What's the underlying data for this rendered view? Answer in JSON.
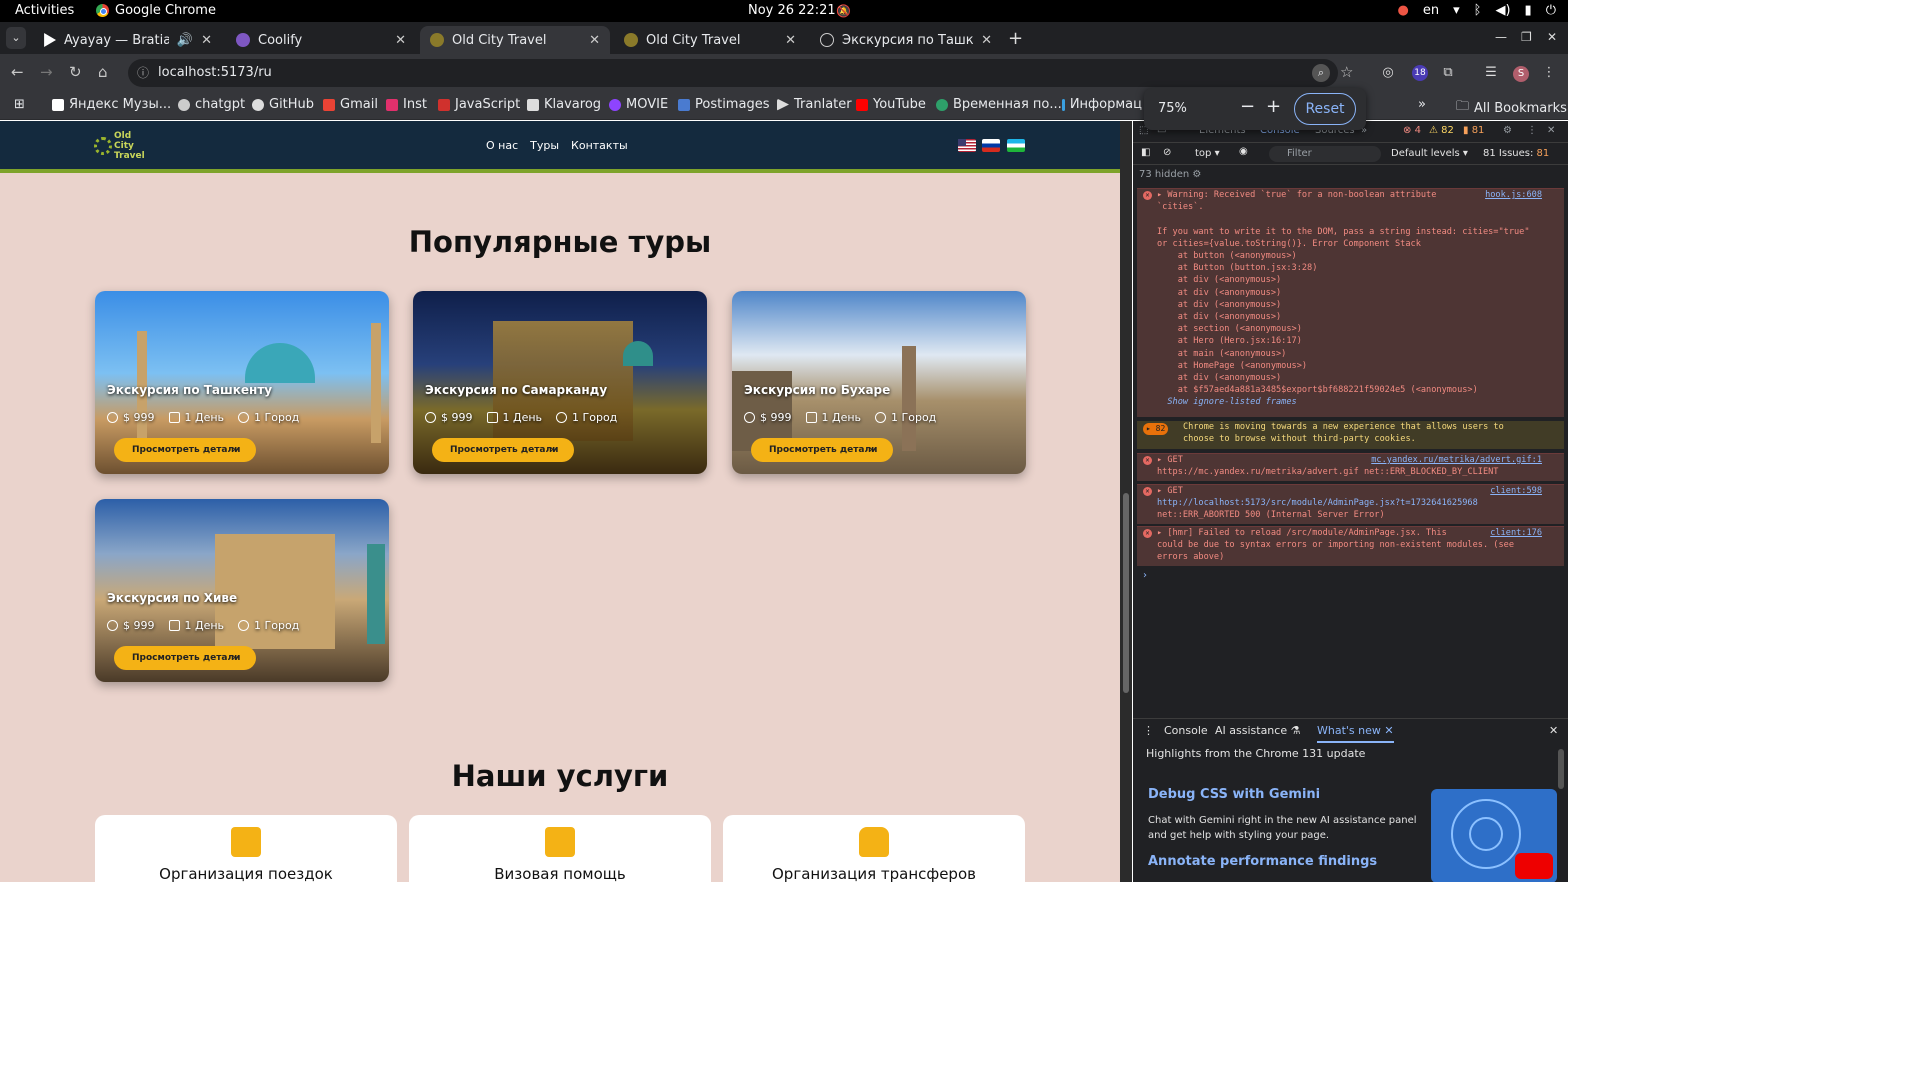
{
  "system": {
    "activities": "Activities",
    "app_name": "Google Chrome",
    "clock": "Noy 26  22:21",
    "lang": "en"
  },
  "tabs": [
    {
      "title": "Ayayay — Bratia Stere",
      "color": "#ffffff"
    },
    {
      "title": "Coolify",
      "color": "#7e57c2"
    },
    {
      "title": "Old City Travel",
      "color": "#8a7a2a"
    },
    {
      "title": "Old City Travel",
      "color": "#8a7a2a"
    },
    {
      "title": "Экскурсия по Ташкенту",
      "color": "#cccccc"
    }
  ],
  "address": "localhost:5173/ru",
  "extension_badge": "18",
  "avatar_letter": "S",
  "bookmarks": [
    {
      "label": "Яндекс Музы...",
      "color": "#ffffff"
    },
    {
      "label": "chatgpt",
      "color": "#cccccc"
    },
    {
      "label": "GitHub",
      "color": "#dddddd"
    },
    {
      "label": "Gmail",
      "color": "#ea4335"
    },
    {
      "label": "Inst",
      "color": "#e1306c"
    },
    {
      "label": "JavaScript",
      "color": "#d0312d"
    },
    {
      "label": "Klavarog",
      "color": "#dddddd"
    },
    {
      "label": "MOVIE",
      "color": "#8e44ff"
    },
    {
      "label": "Postimages",
      "color": "#4a7bd0"
    },
    {
      "label": "Tranlater",
      "color": "#dddddd"
    },
    {
      "label": "YouTube",
      "color": "#ff0000"
    },
    {
      "label": "Временная по...",
      "color": "#2ea06a"
    },
    {
      "label": "Информац",
      "color": "#3aa0e0"
    }
  ],
  "all_bookmarks": "All Bookmarks",
  "zoom": {
    "value": "75%",
    "minus": "−",
    "plus": "+",
    "reset": "Reset"
  },
  "site": {
    "logo_lines": [
      "Old",
      "City",
      "Travel"
    ],
    "nav": [
      "О нас",
      "Туры",
      "Контакты"
    ],
    "popular_title": "Популярные туры",
    "tours": [
      {
        "title": "Экскурсия по Ташкенту",
        "price": "$ 999",
        "days": "1 День",
        "cities": "1 Город",
        "button": "Просмотреть детали"
      },
      {
        "title": "Экскурсия по Самарканду",
        "price": "$ 999",
        "days": "1 День",
        "cities": "1 Город",
        "button": "Просмотреть детали"
      },
      {
        "title": "Экскурсия по Бухаре",
        "price": "$ 999",
        "days": "1 День",
        "cities": "1 Город",
        "button": "Просмотреть детали"
      },
      {
        "title": "Экскурсия по Хиве",
        "price": "$ 999",
        "days": "1 День",
        "cities": "1 Город",
        "button": "Просмотреть детали"
      }
    ],
    "services_title": "Наши услуги",
    "services": [
      "Организация поездок",
      "Визовая помощь",
      "Организация трансферов"
    ]
  },
  "devtools": {
    "tabs": [
      "Elements",
      "Console",
      "Sources"
    ],
    "err_count": "4",
    "warn_count": "82",
    "issue_count": "81",
    "context": "top",
    "filter": "Filter",
    "levels": "Default levels",
    "issues": "81 Issues:",
    "issues_n": "81",
    "hidden": "73 hidden",
    "log1": [
      "Warning: Received `true` for a non-boolean attribute",
      "`cities`.",
      "",
      "If you want to write it to the DOM, pass a string instead: cities=\"true\"",
      "or cities={value.toString()}. Error Component Stack",
      "    at button (<anonymous>)",
      "    at Button (button.jsx:3:28)",
      "    at div (<anonymous>)",
      "    at div (<anonymous>)",
      "    at div (<anonymous>)",
      "    at div (<anonymous>)",
      "    at section (<anonymous>)",
      "    at Hero (Hero.jsx:16:17)",
      "    at main (<anonymous>)",
      "    at HomePage (<anonymous>)",
      "    at div (<anonymous>)",
      "    at $f57aed4a881a3485$export$bf688221f59024e5 (<anonymous>)"
    ],
    "log1_src": "hook.js:608",
    "show_ignore": "Show ignore-listed frames",
    "log2_badge": "82",
    "log2": [
      "Chrome is moving towards a new experience that allows users to",
      "choose to browse without third-party cookies."
    ],
    "log3": [
      "GET",
      "https://mc.yandex.ru/metrika/advert.gif net::ERR_BLOCKED_BY_CLIENT"
    ],
    "log3_src": "mc.yandex.ru/metrika/advert.gif:1",
    "log4": [
      "GET",
      "http://localhost:5173/src/module/AdminPage.jsx?t=1732641625968",
      "net::ERR_ABORTED 500 (Internal Server Error)"
    ],
    "log4_src": "client:598",
    "log5": [
      "[hmr] Failed to reload /src/module/AdminPage.jsx. This",
      "could be due to syntax errors or importing non-existent modules. (see",
      "errors above)"
    ],
    "log5_src": "client:176",
    "drawer_tabs": [
      "Console",
      "AI assistance",
      "What's new"
    ],
    "highlights": "Highlights from the Chrome 131 update",
    "wn1_title": "Debug CSS with Gemini",
    "wn1_text": [
      "Chat with Gemini right in the new AI assistance panel",
      "and get help with styling your page."
    ],
    "wn2_title": "Annotate performance findings"
  }
}
